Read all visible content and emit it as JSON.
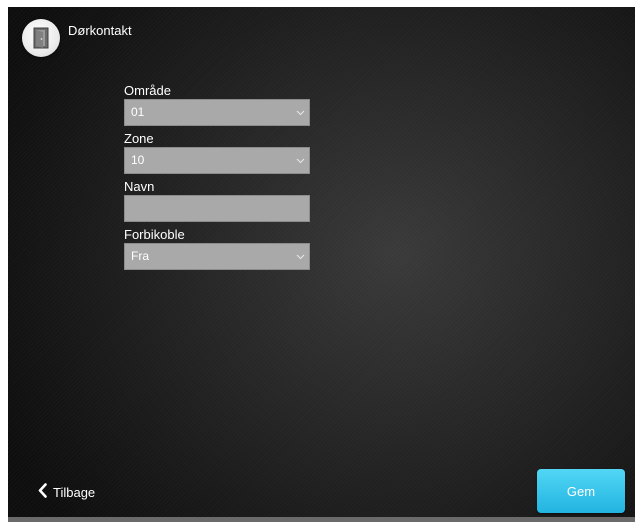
{
  "header": {
    "icon": "door-icon",
    "title": "Dørkontakt"
  },
  "form": {
    "area": {
      "label": "Område",
      "value": "01"
    },
    "zone": {
      "label": "Zone",
      "value": "10"
    },
    "name": {
      "label": "Navn",
      "value": ""
    },
    "bypass": {
      "label": "Forbikoble",
      "value": "Fra"
    }
  },
  "footer": {
    "back_label": "Tilbage",
    "save_label": "Gem"
  },
  "colors": {
    "accent": "#2bbbe6",
    "field_bg": "#a9a9a9"
  }
}
